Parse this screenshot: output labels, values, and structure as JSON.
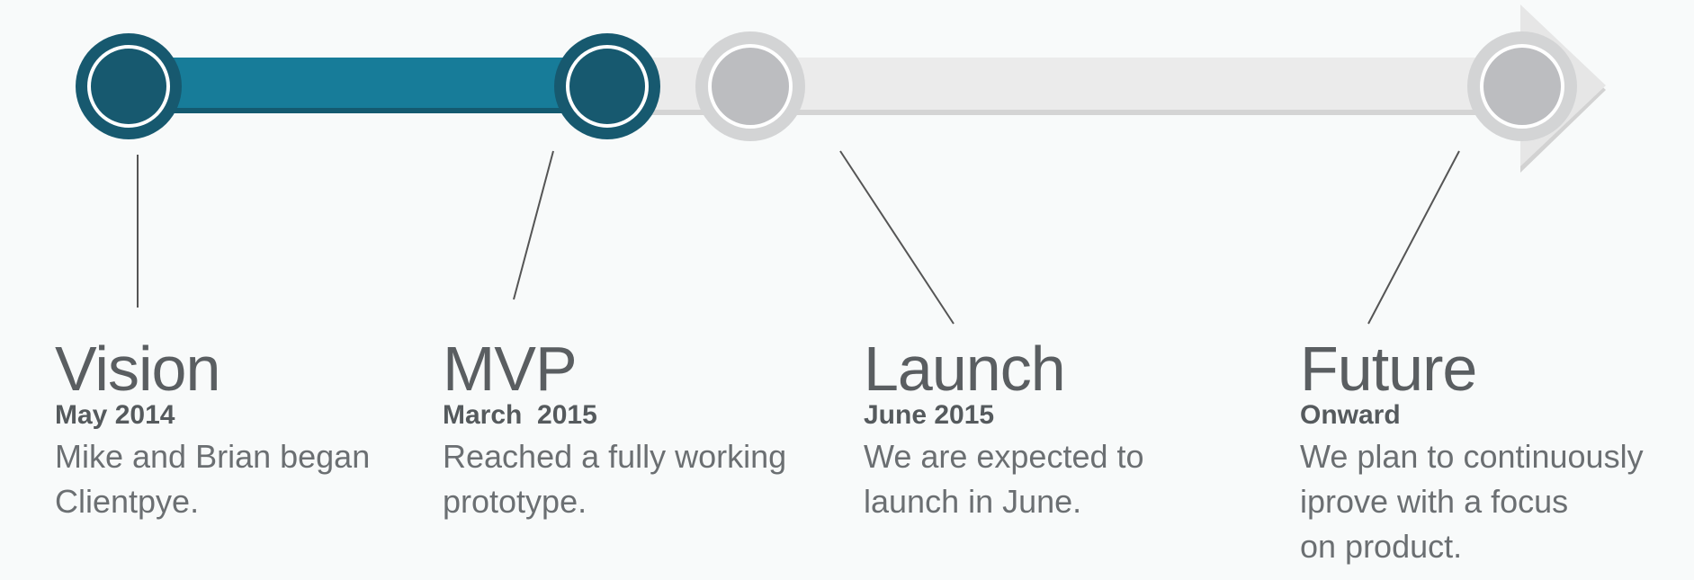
{
  "colors": {
    "done_fill": "#17596f",
    "done_bar": "#177c99",
    "done_bar_shadow": "#145a70",
    "pending_fill": "#bcbdc0",
    "pending_ring": "#d3d4d5",
    "track": "#ebebeb",
    "track_shadow": "#d4d4d4",
    "arrow": "#e6e6e6",
    "arrow_shadow": "#d2d2d2",
    "leader_line": "#555555"
  },
  "progress": {
    "completed_milestones": 2,
    "total_milestones": 4
  },
  "milestones": [
    {
      "title": "Vision",
      "date": "May 2014",
      "description": "Mike and Brian began\nClientpye.",
      "status": "done"
    },
    {
      "title": "MVP",
      "date": "March  2015",
      "description": "Reached a fully working\nprototype.",
      "status": "done"
    },
    {
      "title": "Launch",
      "date": "June 2015",
      "description": "We are expected to\nlaunch in June.",
      "status": "pending"
    },
    {
      "title": "Future",
      "date": "Onward",
      "description": "We plan to continuously\niprove with a focus\non product.",
      "status": "pending"
    }
  ]
}
